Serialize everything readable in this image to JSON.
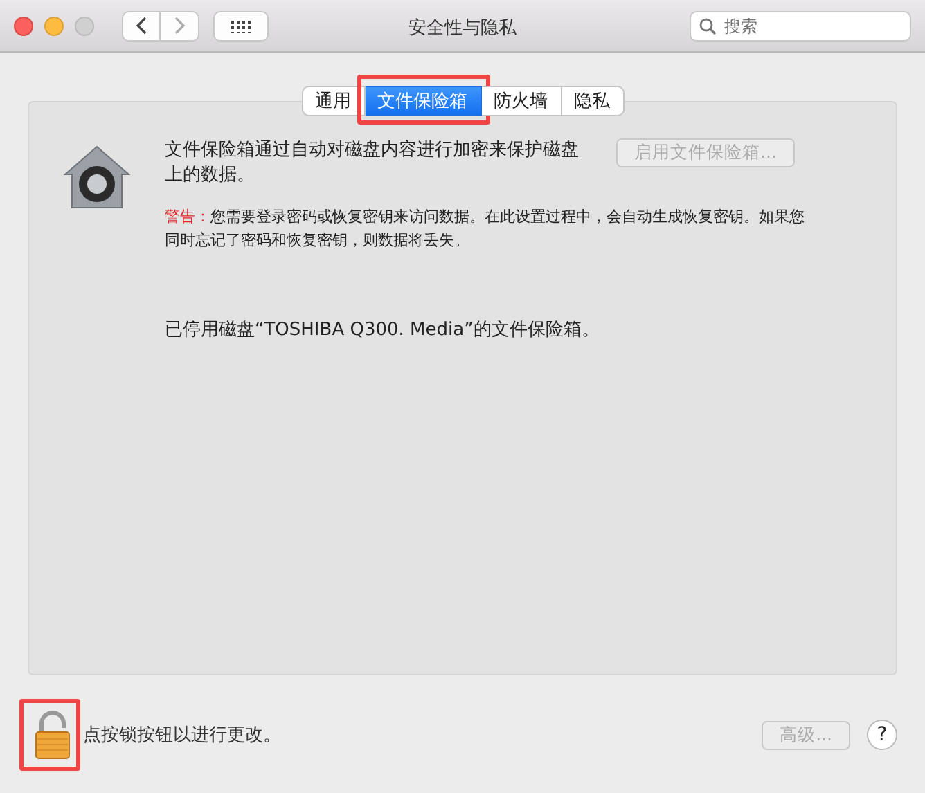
{
  "window": {
    "title": "安全性与隐私",
    "search": {
      "placeholder": "搜索"
    }
  },
  "tabs": [
    {
      "label": "通用",
      "selected": false,
      "highlighted": false
    },
    {
      "label": "文件保险箱",
      "selected": true,
      "highlighted": true
    },
    {
      "label": "防火墙",
      "selected": false,
      "highlighted": false
    },
    {
      "label": "隐私",
      "selected": false,
      "highlighted": false
    }
  ],
  "filevault": {
    "description": "文件保险箱通过自动对磁盘内容进行加密来保护磁盘上的数据。",
    "enable_button": {
      "label": "启用文件保险箱...",
      "disabled": true
    },
    "warning_label": "警告：",
    "warning_text": "您需要登录密码或恢复密钥来访问数据。在此设置过程中，会自动生成恢复密钥。如果您同时忘记了密码和恢复密钥，则数据将丢失。",
    "status": "已停用磁盘“TOSHIBA Q300. Media”的文件保险箱。"
  },
  "footer": {
    "lock": {
      "locked": false,
      "highlighted": true
    },
    "lock_text": "点按锁按钮以进行更改。",
    "advanced_button": {
      "label": "高级...",
      "disabled": true
    },
    "help_button": "?"
  }
}
